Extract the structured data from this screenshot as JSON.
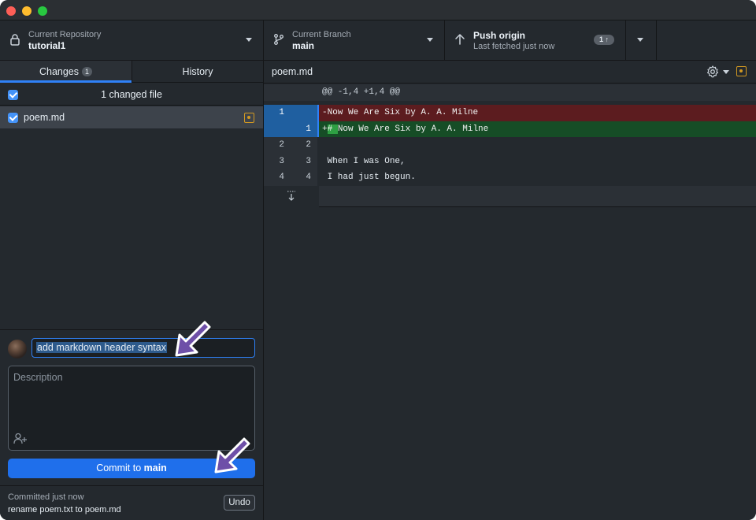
{
  "toolbar": {
    "repo": {
      "label": "Current Repository",
      "value": "tutorial1"
    },
    "branch": {
      "label": "Current Branch",
      "value": "main"
    },
    "push": {
      "title": "Push origin",
      "subtitle": "Last fetched just now",
      "badge": "1 ↑"
    }
  },
  "tabs": {
    "changes": {
      "label": "Changes",
      "count": "1"
    },
    "history": {
      "label": "History"
    }
  },
  "changes": {
    "header": "1 changed file",
    "files": [
      {
        "name": "poem.md",
        "status": "modified"
      }
    ]
  },
  "commit": {
    "summary": "add markdown header syntax",
    "description_placeholder": "Description",
    "button_prefix": "Commit to ",
    "button_branch": "main"
  },
  "last_commit": {
    "time": "Committed just now",
    "message": "rename poem.txt to poem.md",
    "undo_label": "Undo"
  },
  "diff": {
    "filename": "poem.md",
    "hunk_header": "@@ -1,4 +1,4 @@",
    "lines": [
      {
        "type": "del",
        "old": "1",
        "new": "",
        "prefix": "-",
        "text": "Now We Are Six by A. A. Milne",
        "highlight": ""
      },
      {
        "type": "add",
        "old": "",
        "new": "1",
        "prefix": "+",
        "highlight": "# ",
        "text": "Now We Are Six by A. A. Milne"
      },
      {
        "type": "ctx",
        "old": "2",
        "new": "2",
        "prefix": " ",
        "text": "",
        "highlight": ""
      },
      {
        "type": "ctx",
        "old": "3",
        "new": "3",
        "prefix": " ",
        "text": "When I was One,",
        "highlight": ""
      },
      {
        "type": "ctx",
        "old": "4",
        "new": "4",
        "prefix": " ",
        "text": "I had just begun.",
        "highlight": ""
      }
    ]
  },
  "colors": {
    "accent": "#1f6feb",
    "deleted_bg": "#5c1c1f",
    "added_bg": "#164d26",
    "modified_icon": "#d29922",
    "annotation_arrow": "#6e4fa8"
  },
  "icons": {
    "repo": "lock-icon",
    "branch": "git-branch-icon",
    "push": "arrow-up-icon",
    "settings": "gear-icon",
    "file_status": "modified-file-icon",
    "coauthor": "add-coauthor-icon",
    "expand": "expand-down-icon"
  }
}
